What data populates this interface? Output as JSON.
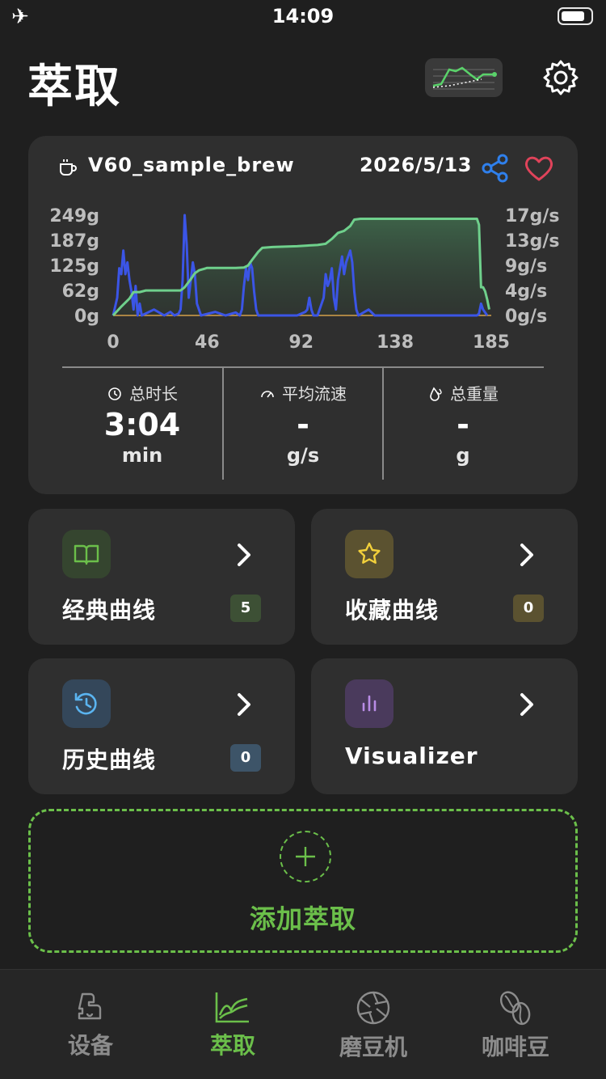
{
  "status_bar": {
    "time": "14:09",
    "airplane_icon": "airplane-icon",
    "battery_icon": "battery-icon"
  },
  "header": {
    "title": "萃取",
    "mini_graph_icon": "mini-curve-icon",
    "settings_icon": "gear-icon"
  },
  "brew_card": {
    "name": "V60_sample_brew",
    "date": "2026/5/13",
    "icons": {
      "cup": "coffee-cup-icon",
      "share": "share-icon",
      "favorite": "heart-icon"
    },
    "colors": {
      "share": "#2f80ed",
      "heart": "#e0435a",
      "weight_line": "#6fd08c",
      "flow_line": "#3b55e6",
      "baseline": "#d4a04a"
    },
    "stats": [
      {
        "label": "总时长",
        "value": "3:04",
        "unit": "min",
        "icon": "clock-icon"
      },
      {
        "label": "平均流速",
        "value": "-",
        "unit": "g/s",
        "icon": "gauge-icon"
      },
      {
        "label": "总重量",
        "value": "-",
        "unit": "g",
        "icon": "drop-icon"
      }
    ]
  },
  "chart_data": {
    "type": "line",
    "x_ticks": [
      "0",
      "46",
      "92",
      "138",
      "185"
    ],
    "y_left_ticks": [
      "249g",
      "187g",
      "125g",
      "62g",
      "0g"
    ],
    "y_right_ticks": [
      "17g/s",
      "13g/s",
      "9g/s",
      "4g/s",
      "0g/s"
    ],
    "xlim": [
      0,
      185
    ],
    "ylim_left": [
      0,
      249
    ],
    "ylim_right": [
      0,
      17
    ],
    "series": [
      {
        "axis": "left",
        "points": [
          [
            0,
            0
          ],
          [
            4,
            22
          ],
          [
            8,
            42
          ],
          [
            10,
            58
          ],
          [
            13,
            58
          ],
          [
            16,
            62
          ],
          [
            30,
            62
          ],
          [
            33,
            62
          ],
          [
            35,
            70
          ],
          [
            38,
            90
          ],
          [
            40,
            105
          ],
          [
            42,
            112
          ],
          [
            46,
            118
          ],
          [
            60,
            118
          ],
          [
            64,
            119
          ],
          [
            66,
            124
          ],
          [
            68,
            138
          ],
          [
            71,
            158
          ],
          [
            73,
            168
          ],
          [
            78,
            170
          ],
          [
            90,
            172
          ],
          [
            100,
            175
          ],
          [
            104,
            178
          ],
          [
            107,
            190
          ],
          [
            110,
            205
          ],
          [
            113,
            210
          ],
          [
            116,
            222
          ],
          [
            118,
            238
          ],
          [
            121,
            240
          ],
          [
            130,
            240
          ],
          [
            150,
            240
          ],
          [
            172,
            240
          ],
          [
            178,
            240
          ],
          [
            179,
            225
          ],
          [
            180,
            70
          ],
          [
            181,
            70
          ],
          [
            182,
            60
          ],
          [
            183,
            40
          ],
          [
            184,
            15
          ]
        ]
      },
      {
        "axis": "right",
        "points": [
          [
            0,
            0
          ],
          [
            2,
            3
          ],
          [
            3,
            8
          ],
          [
            4,
            7
          ],
          [
            5,
            11
          ],
          [
            6,
            7
          ],
          [
            7,
            9
          ],
          [
            8,
            6
          ],
          [
            9,
            4
          ],
          [
            10,
            1
          ],
          [
            11,
            5
          ],
          [
            12,
            0
          ],
          [
            13,
            2
          ],
          [
            14,
            0
          ],
          [
            20,
            1
          ],
          [
            25,
            0
          ],
          [
            28,
            0.6
          ],
          [
            30,
            0
          ],
          [
            32,
            0.3
          ],
          [
            33,
            1
          ],
          [
            34,
            6
          ],
          [
            35,
            17
          ],
          [
            36,
            12
          ],
          [
            37,
            3
          ],
          [
            38,
            6
          ],
          [
            39,
            9
          ],
          [
            40,
            7
          ],
          [
            41,
            2
          ],
          [
            42,
            1
          ],
          [
            43,
            0
          ],
          [
            50,
            0.6
          ],
          [
            55,
            0
          ],
          [
            60,
            0.5
          ],
          [
            62,
            0
          ],
          [
            63,
            1
          ],
          [
            64,
            5
          ],
          [
            65,
            8
          ],
          [
            66,
            6
          ],
          [
            67,
            9
          ],
          [
            68,
            8
          ],
          [
            69,
            4
          ],
          [
            70,
            1
          ],
          [
            71,
            0
          ],
          [
            80,
            0
          ],
          [
            90,
            0
          ],
          [
            94,
            0.6
          ],
          [
            95,
            1
          ],
          [
            96,
            3
          ],
          [
            97,
            1
          ],
          [
            98,
            0
          ],
          [
            100,
            0
          ],
          [
            103,
            3
          ],
          [
            104,
            7
          ],
          [
            105,
            5
          ],
          [
            106,
            6
          ],
          [
            107,
            8
          ],
          [
            108,
            3
          ],
          [
            109,
            1
          ],
          [
            110,
            6
          ],
          [
            111,
            8
          ],
          [
            112,
            10
          ],
          [
            113,
            7
          ],
          [
            114,
            9
          ],
          [
            115,
            10
          ],
          [
            116,
            11
          ],
          [
            117,
            9
          ],
          [
            118,
            4
          ],
          [
            119,
            1
          ],
          [
            120,
            0
          ],
          [
            125,
            1
          ],
          [
            128,
            0
          ],
          [
            178,
            0
          ],
          [
            179,
            0.3
          ],
          [
            180,
            2
          ],
          [
            181,
            1
          ],
          [
            182,
            0.5
          ],
          [
            183,
            0
          ]
        ]
      },
      {
        "axis": "left",
        "points": [
          [
            0,
            0
          ],
          [
            185,
            0
          ]
        ]
      }
    ]
  },
  "tiles": [
    {
      "label": "经典曲线",
      "badge": "5",
      "icon": "book-icon",
      "icon_bg": "#35452f",
      "badge_bg": "#3d5035",
      "icon_color": "#6bbf4a"
    },
    {
      "label": "收藏曲线",
      "badge": "0",
      "icon": "star-icon",
      "icon_bg": "#5b5230",
      "badge_bg": "#5b5230",
      "icon_color": "#f2d03b"
    },
    {
      "label": "历史曲线",
      "badge": "0",
      "icon": "history-icon",
      "icon_bg": "#34475a",
      "badge_bg": "#3d5468",
      "icon_color": "#5ab4f0"
    },
    {
      "label": "Visualizer",
      "icon": "bar-chart-icon",
      "icon_bg": "#4a3a5c",
      "icon_color": "#b98ce6"
    }
  ],
  "add_brew": {
    "label": "添加萃取",
    "icon": "plus-icon",
    "color": "#6bbf4a"
  },
  "bottom_nav": {
    "active_color": "#6bbf4a",
    "inactive_color": "#8c8c8c",
    "items": [
      {
        "label": "设备",
        "icon": "scale-device-icon",
        "active": false
      },
      {
        "label": "萃取",
        "icon": "line-chart-icon",
        "active": true
      },
      {
        "label": "磨豆机",
        "icon": "aperture-icon",
        "active": false
      },
      {
        "label": "咖啡豆",
        "icon": "coffee-bean-icon",
        "active": false
      }
    ]
  }
}
